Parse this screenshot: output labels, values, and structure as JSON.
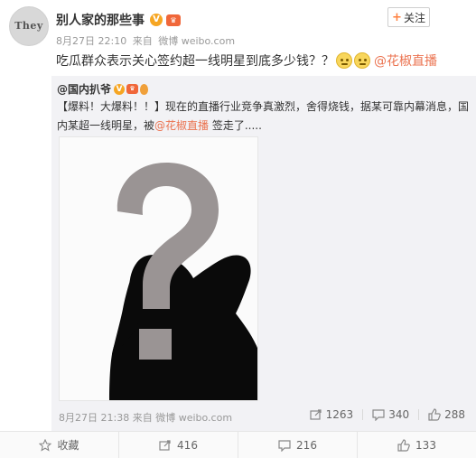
{
  "post": {
    "avatar_text": "They",
    "author": "别人家的那些事",
    "follow_label": "关注",
    "time": "8月27日 22:10",
    "source_prefix": "来自",
    "source": "微博 weibo.com",
    "text": "吃瓜群众表示关心签约超一线明星到底多少钱？？",
    "mention": "@花椒直播"
  },
  "repost": {
    "author": "@国内扒爷",
    "text_before": "【爆料！大爆料！！】现在的直播行业竞争真激烈，舍得烧钱，据某可靠内幕消息，国内某超一线明星，被",
    "mention": "@花椒直播",
    "text_after": " 签走了.....",
    "time": "8月27日 21:38",
    "source_prefix": "来自",
    "source": "微博 weibo.com",
    "reposts": "1263",
    "comments": "340",
    "likes": "288"
  },
  "footer": {
    "favorite_label": "收藏",
    "repost_count": "416",
    "comment_count": "216",
    "like_count": "133"
  },
  "colors": {
    "accent": "#eb7350",
    "follow_plus": "#ff8140",
    "silhouette": "#0a0a0a",
    "question_mark": "#9a9494"
  }
}
